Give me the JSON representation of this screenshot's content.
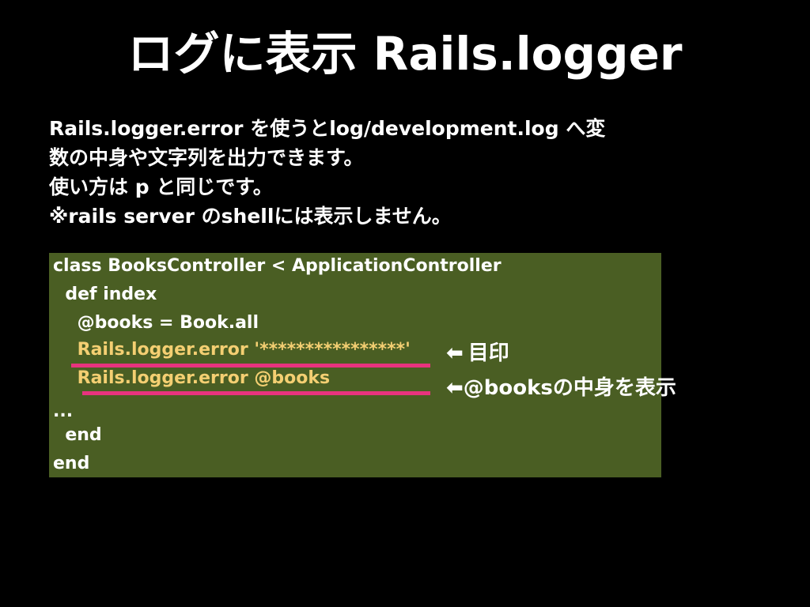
{
  "slide": {
    "title": "ログに表示 Rails.logger",
    "description": [
      "Rails.logger.error を使うとlog/development.log へ変",
      "数の中身や文字列を出力できます。",
      "使い方は p と同じです。",
      "※rails server のshellには表示しません。"
    ],
    "code": [
      "class BooksController < ApplicationController",
      "  def index",
      "    @books = Book.all",
      "    Rails.logger.error '****************'",
      "    Rails.logger.error @books",
      "...",
      "  end",
      "end"
    ],
    "notes": {
      "marker_label": "目印",
      "books_label": "@booksの中身を表示",
      "arrow_glyph": "⬅"
    },
    "colors": {
      "background": "#000000",
      "code_background": "#4a5e23",
      "highlight_text": "#f4cf72",
      "underline": "#e8337e",
      "text": "#ffffff"
    }
  }
}
